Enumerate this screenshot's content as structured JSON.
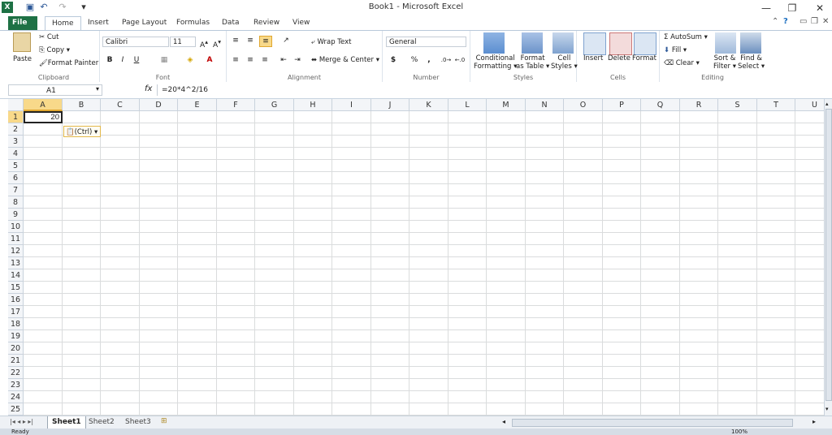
{
  "window": {
    "title": "Book1 - Microsoft Excel"
  },
  "tabs": [
    "File",
    "Home",
    "Insert",
    "Page Layout",
    "Formulas",
    "Data",
    "Review",
    "View"
  ],
  "clipboard": {
    "paste": "Paste",
    "cut": "Cut",
    "copy": "Copy",
    "format_painter": "Format Painter",
    "label": "Clipboard"
  },
  "font": {
    "name": "Calibri",
    "size": "11",
    "bold": "B",
    "italic": "I",
    "underline": "U",
    "label": "Font"
  },
  "alignment": {
    "wrap_text": "Wrap Text",
    "merge_center": "Merge & Center",
    "label": "Alignment"
  },
  "number": {
    "format": "General",
    "currency": "$",
    "percent": "%",
    "comma": ",",
    "label": "Number"
  },
  "styles": {
    "conditional_1": "Conditional",
    "conditional_2": "Formatting",
    "format_table_1": "Format",
    "format_table_2": "as Table",
    "cell_styles_1": "Cell",
    "cell_styles_2": "Styles",
    "label": "Styles"
  },
  "cells": {
    "insert": "Insert",
    "delete": "Delete",
    "format": "Format",
    "label": "Cells"
  },
  "editing": {
    "autosum": "AutoSum",
    "fill": "Fill",
    "clear": "Clear",
    "sort_1": "Sort &",
    "sort_2": "Filter",
    "find_1": "Find &",
    "find_2": "Select",
    "label": "Editing"
  },
  "formula_bar": {
    "name_box": "A1",
    "fx": "fx",
    "formula": "=20*4^2/16"
  },
  "columns": [
    "A",
    "B",
    "C",
    "D",
    "E",
    "F",
    "G",
    "H",
    "I",
    "J",
    "K",
    "L",
    "M",
    "N",
    "O",
    "P",
    "Q",
    "R",
    "S",
    "T",
    "U"
  ],
  "rows": [
    "1",
    "2",
    "3",
    "4",
    "5",
    "6",
    "7",
    "8",
    "9",
    "10",
    "11",
    "12",
    "13",
    "14",
    "15",
    "16",
    "17",
    "18",
    "19",
    "20",
    "21",
    "22",
    "23",
    "24",
    "25"
  ],
  "cell_a1": "20",
  "paste_options": "(Ctrl)",
  "sheets": [
    "Sheet1",
    "Sheet2",
    "Sheet3"
  ],
  "status": {
    "ready": "Ready",
    "zoom": "100%"
  },
  "colors": {
    "file_tab": "#1e7145",
    "selection_header": "#f8d98a",
    "grid_line": "#dadcdd"
  }
}
